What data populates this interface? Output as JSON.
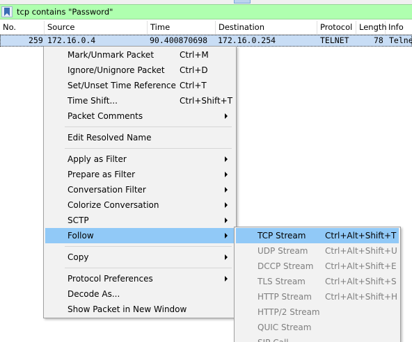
{
  "filter": {
    "text": "tcp contains \"Password\""
  },
  "columns": [
    "No.",
    "Source",
    "Time",
    "Destination",
    "Protocol",
    "Length",
    "Info"
  ],
  "packet_row": {
    "no": "259",
    "source": "172.16.0.4",
    "time": "90.400870698",
    "destination": "172.16.0.254",
    "protocol": "TELNET",
    "length": "78",
    "info": "Telne"
  },
  "context_menu": {
    "groups": [
      [
        {
          "label": "Mark/Unmark Packet",
          "shortcut": "Ctrl+M",
          "submenu": false
        },
        {
          "label": "Ignore/Unignore Packet",
          "shortcut": "Ctrl+D",
          "submenu": false
        },
        {
          "label": "Set/Unset Time Reference",
          "shortcut": "Ctrl+T",
          "submenu": false
        },
        {
          "label": "Time Shift...",
          "shortcut": "Ctrl+Shift+T",
          "submenu": false
        },
        {
          "label": "Packet Comments",
          "shortcut": "",
          "submenu": true
        }
      ],
      [
        {
          "label": "Edit Resolved Name",
          "shortcut": "",
          "submenu": false
        }
      ],
      [
        {
          "label": "Apply as Filter",
          "shortcut": "",
          "submenu": true
        },
        {
          "label": "Prepare as Filter",
          "shortcut": "",
          "submenu": true
        },
        {
          "label": "Conversation Filter",
          "shortcut": "",
          "submenu": true
        },
        {
          "label": "Colorize Conversation",
          "shortcut": "",
          "submenu": true
        },
        {
          "label": "SCTP",
          "shortcut": "",
          "submenu": true
        },
        {
          "label": "Follow",
          "shortcut": "",
          "submenu": true,
          "highlighted": true
        }
      ],
      [
        {
          "label": "Copy",
          "shortcut": "",
          "submenu": true
        }
      ],
      [
        {
          "label": "Protocol Preferences",
          "shortcut": "",
          "submenu": true
        },
        {
          "label": "Decode As...",
          "shortcut": "",
          "submenu": false
        },
        {
          "label": "Show Packet in New Window",
          "shortcut": "",
          "submenu": false
        }
      ]
    ]
  },
  "follow_submenu": {
    "items": [
      {
        "label": "TCP Stream",
        "shortcut": "Ctrl+Alt+Shift+T",
        "enabled": true,
        "highlighted": true
      },
      {
        "label": "UDP Stream",
        "shortcut": "Ctrl+Alt+Shift+U",
        "enabled": false
      },
      {
        "label": "DCCP Stream",
        "shortcut": "Ctrl+Alt+Shift+E",
        "enabled": false
      },
      {
        "label": "TLS Stream",
        "shortcut": "Ctrl+Alt+Shift+S",
        "enabled": false
      },
      {
        "label": "HTTP Stream",
        "shortcut": "Ctrl+Alt+Shift+H",
        "enabled": false
      },
      {
        "label": "HTTP/2 Stream",
        "shortcut": "",
        "enabled": false
      },
      {
        "label": "QUIC Stream",
        "shortcut": "",
        "enabled": false
      },
      {
        "label": "SIP Call",
        "shortcut": "",
        "enabled": false
      }
    ]
  },
  "colors": {
    "filter_bg": "#afffaf",
    "selected_row_bg": "#c8ddf5",
    "menu_bg": "#f2f2f2",
    "menu_highlight": "#91c9f7",
    "disabled_text": "#7e7e7e"
  },
  "icons": {
    "bookmark": "bookmark-icon",
    "submenu_arrow": "chevron-right-icon"
  }
}
